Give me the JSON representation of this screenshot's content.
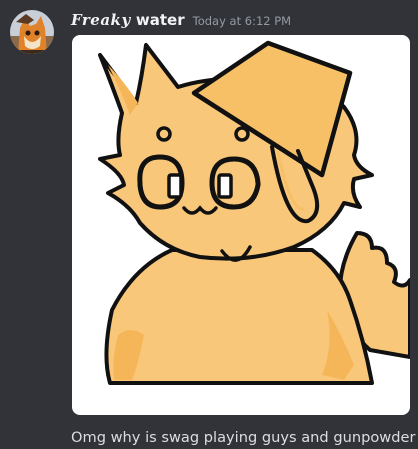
{
  "message": {
    "author": {
      "name_styled": "Freaky",
      "name_plain": "water",
      "avatar": "fox-character-avatar"
    },
    "timestamp": "Today at 6:12 PM",
    "attachment": {
      "type": "image",
      "subject": "orange cat character with bucket on head"
    },
    "content": "Omg why is swag playing guys and gunpowder"
  },
  "colors": {
    "background": "#313338",
    "username": "#f2f3f5",
    "timestamp": "#949ba4",
    "text": "#dbdee1",
    "character_fill": "#f9c77a",
    "bucket_fill": "#f7bf66",
    "outline": "#111111"
  }
}
